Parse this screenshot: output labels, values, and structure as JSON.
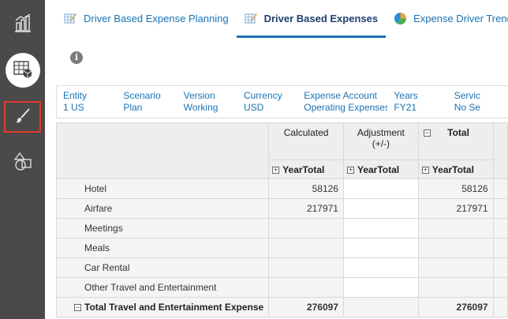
{
  "sidebar": {
    "items": [
      {
        "icon": "bar-chart-icon"
      },
      {
        "icon": "grid-cube-icon"
      },
      {
        "icon": "paintbrush-icon"
      },
      {
        "icon": "shapes-icon"
      }
    ]
  },
  "tabs": [
    {
      "label": "Driver Based Expense Planning",
      "icon": "form-edit-icon"
    },
    {
      "label": "Driver Based Expenses",
      "icon": "form-edit-icon"
    },
    {
      "label": "Expense Driver Trends",
      "icon": "pie-chart-icon"
    }
  ],
  "info_icon_glyph": "i",
  "pov": [
    {
      "label": "Entity",
      "value": "1 US"
    },
    {
      "label": "Scenario",
      "value": "Plan"
    },
    {
      "label": "Version",
      "value": "Working"
    },
    {
      "label": "Currency",
      "value": "USD"
    },
    {
      "label": "Expense Account",
      "value": "Operating Expenses"
    },
    {
      "label": "Years",
      "value": "FY21"
    },
    {
      "label": "Servic",
      "value": "No Se"
    }
  ],
  "grid": {
    "columns": [
      {
        "line1": "Calculated",
        "line2": "",
        "sub": "YearTotal"
      },
      {
        "line1": "Adjustment",
        "line2": "(+/-)",
        "sub": "YearTotal"
      },
      {
        "line1": "Total",
        "line2": "",
        "sub": "YearTotal"
      }
    ],
    "expand_glyph": "+",
    "collapse_glyph": "−",
    "rows": [
      {
        "label": "Hotel",
        "calculated": "58126",
        "adjustment": "",
        "total": "58126"
      },
      {
        "label": "Airfare",
        "calculated": "217971",
        "adjustment": "",
        "total": "217971"
      },
      {
        "label": "Meetings",
        "calculated": "",
        "adjustment": "",
        "total": ""
      },
      {
        "label": "Meals",
        "calculated": "",
        "adjustment": "",
        "total": ""
      },
      {
        "label": "Car Rental",
        "calculated": "",
        "adjustment": "",
        "total": ""
      },
      {
        "label": "Other Travel and Entertainment",
        "calculated": "",
        "adjustment": "",
        "total": ""
      }
    ],
    "total_row": {
      "label": "Total Travel and Entertainment Expense",
      "calculated": "276097",
      "adjustment": "",
      "total": "276097"
    }
  },
  "colors": {
    "sidebar_bg": "#4a4a4a",
    "link_blue": "#1a73b5",
    "active_tab_underline": "#1f6fb5",
    "highlight_border": "#e03a2f"
  }
}
